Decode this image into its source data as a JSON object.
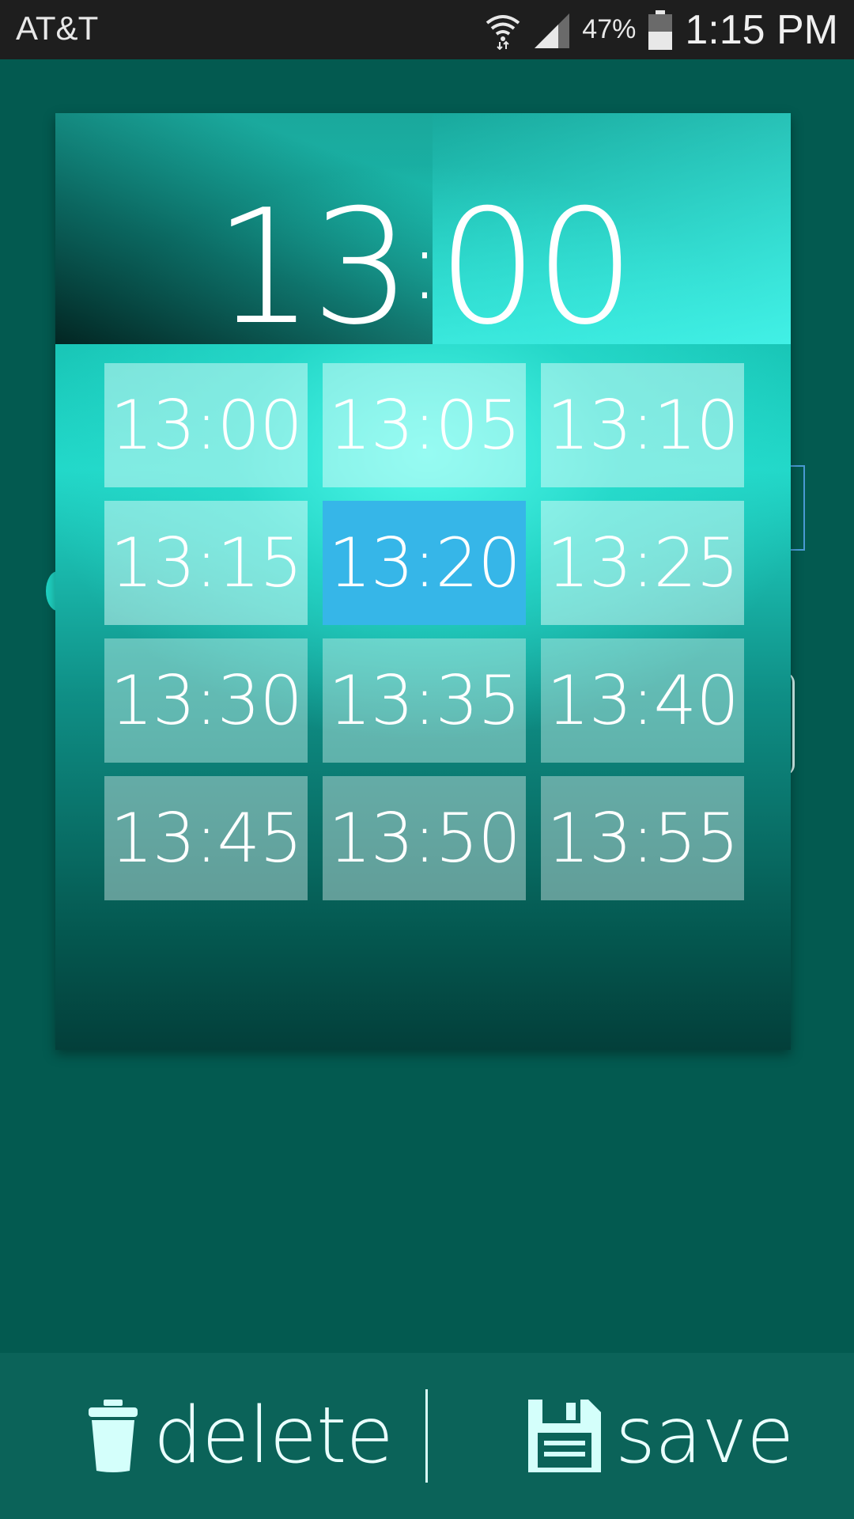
{
  "status_bar": {
    "carrier": "AT&T",
    "battery_percent": "47%",
    "time": "1:15 PM",
    "icons": [
      "wifi-icon",
      "signal-icon",
      "battery-icon"
    ]
  },
  "dialog": {
    "current_time": {
      "hours": "13",
      "separator": ":",
      "minutes": "00"
    },
    "options": [
      {
        "label": "13:00",
        "selected": false
      },
      {
        "label": "13:05",
        "selected": false
      },
      {
        "label": "13:10",
        "selected": false
      },
      {
        "label": "13:15",
        "selected": false
      },
      {
        "label": "13:20",
        "selected": true
      },
      {
        "label": "13:25",
        "selected": false
      },
      {
        "label": "13:30",
        "selected": false
      },
      {
        "label": "13:35",
        "selected": false
      },
      {
        "label": "13:40",
        "selected": false
      },
      {
        "label": "13:45",
        "selected": false
      },
      {
        "label": "13:50",
        "selected": false
      },
      {
        "label": "13:55",
        "selected": false
      }
    ]
  },
  "bottom_bar": {
    "delete_label": "delete",
    "save_label": "save",
    "delete_icon": "trash-icon",
    "save_icon": "floppy-disk-icon"
  },
  "colors": {
    "background": "#035a50",
    "selected": "#36b6e8",
    "bottom_bar": "#0b6359",
    "status_bar": "#1e1e1e"
  }
}
